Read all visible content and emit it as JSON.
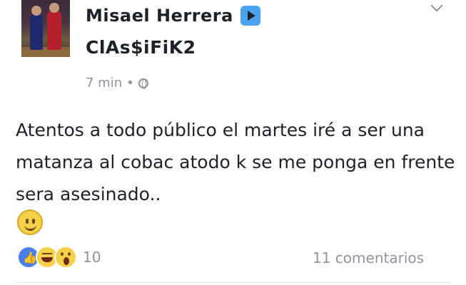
{
  "post": {
    "author": "Misael Herrera",
    "page_name": "ClAs$iFiK2",
    "time": "7 min",
    "separator": "•",
    "text": "Atentos a todo público el martes iré a ser una matanza al cobac atodo k se me ponga en frente sera asesinado.."
  },
  "reactions": {
    "count": "10",
    "types": [
      "like",
      "haha",
      "wow"
    ]
  },
  "comments_label": "11 comentarios",
  "icons": {
    "play": "play-icon",
    "privacy": "globe-icon",
    "menu": "chevron-down-icon",
    "emoji": "smiley-emoji-icon"
  },
  "colors": {
    "accent": "#4aa3f0",
    "meta_text": "#90949c",
    "like_blue": "#4a7ee8",
    "emoji_yellow": "#f7d04a"
  }
}
